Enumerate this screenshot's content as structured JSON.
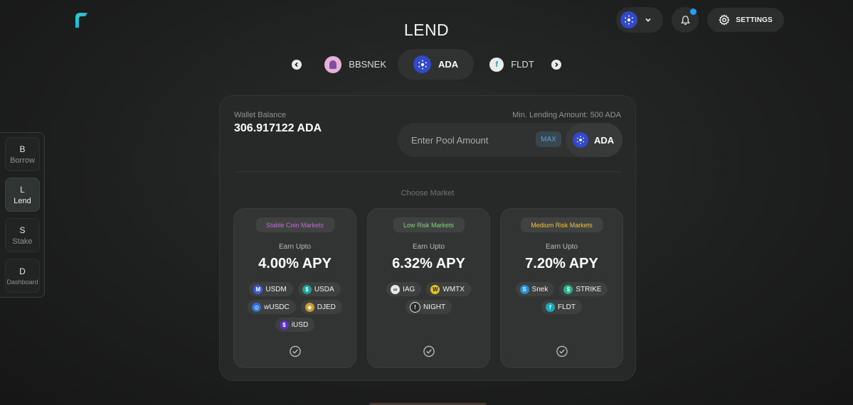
{
  "header": {
    "title": "LEND",
    "settings_label": "SETTINGS"
  },
  "asset_tabs": [
    {
      "label": "BBSNEK",
      "active": false,
      "icon": "bbsnek-coin-icon"
    },
    {
      "label": "ADA",
      "active": true,
      "icon": "ada-coin-icon"
    },
    {
      "label": "FLDT",
      "active": false,
      "icon": "fldt-coin-icon"
    }
  ],
  "sidenav": [
    {
      "letter": "B",
      "label": "Borrow"
    },
    {
      "letter": "L",
      "label": "Lend",
      "active": true
    },
    {
      "letter": "S",
      "label": "Stake"
    },
    {
      "letter": "D",
      "label": "Dashboard"
    }
  ],
  "lend": {
    "wallet_label": "Wallet Balance",
    "wallet_value": "306.917122 ADA",
    "min_lending": "Min. Lending Amount: 500 ADA",
    "amount_placeholder": "Enter Pool Amount",
    "max_label": "MAX",
    "asset": "ADA",
    "choose_market": "Choose Market"
  },
  "markets": [
    {
      "badge": "Stable Coin Markets",
      "badge_color": "#c56bd8",
      "earn_label": "Earn Upto",
      "apy": "4.00% APY",
      "tokens": [
        {
          "name": "USDM",
          "color": "#3b5bdb",
          "glyph": "M"
        },
        {
          "name": "USDA",
          "color": "#1aa39a",
          "glyph": "$"
        },
        {
          "name": "wUSDC",
          "color": "#2f6fd6",
          "glyph": "◎"
        },
        {
          "name": "DJED",
          "color": "#c99a2e",
          "glyph": "◆"
        },
        {
          "name": "iUSD",
          "color": "#5b2fc0",
          "glyph": "$"
        }
      ]
    },
    {
      "badge": "Low Risk Markets",
      "badge_color": "#7fd77b",
      "earn_label": "Earn Upto",
      "apy": "6.32% APY",
      "tokens": [
        {
          "name": "IAG",
          "color": "#e6e8e7",
          "glyph": "∞"
        },
        {
          "name": "WMTX",
          "color": "#e3c11d",
          "glyph": "W"
        },
        {
          "name": "NIGHT",
          "color": "#2a2c2b",
          "glyph": "!"
        }
      ]
    },
    {
      "badge": "Medium Risk Markets",
      "badge_color": "#f0c43a",
      "earn_label": "Earn Upto",
      "apy": "7.20% APY",
      "tokens": [
        {
          "name": "Snek",
          "color": "#1e8fd8",
          "glyph": "S"
        },
        {
          "name": "STRIKE",
          "color": "#26b38c",
          "glyph": "$"
        },
        {
          "name": "FLDT",
          "color": "#1ea7b8",
          "glyph": "f"
        }
      ]
    }
  ],
  "colors": {
    "accent_blue": "#2a9df4",
    "ada_blue": "#3249c7",
    "panel": "#272928"
  }
}
